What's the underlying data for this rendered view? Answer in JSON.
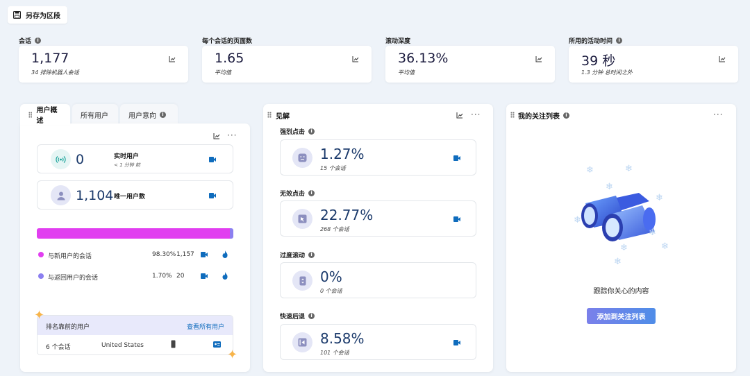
{
  "toolbar": {
    "save_segment_label": "另存为区段"
  },
  "metrics": [
    {
      "label": "会话",
      "value": "1,177",
      "sub": "34 排除机器人会话",
      "has_info": true
    },
    {
      "label": "每个会话的页面数",
      "value": "1.65",
      "sub": "平均值",
      "has_info": false
    },
    {
      "label": "滚动深度",
      "value": "36.13%",
      "sub": "平均值",
      "has_info": false
    },
    {
      "label": "所用的活动时间",
      "value": "39 秒",
      "sub": "1.3 分钟 总时间之外",
      "has_info": true
    }
  ],
  "user_panel": {
    "tabs": [
      "用户概述",
      "所有用户",
      "用户意向"
    ],
    "realtime": {
      "value": "0",
      "label": "实时用户",
      "sub": "< 1 分钟 前"
    },
    "unique": {
      "value": "1,104",
      "label": "唯一用户数"
    },
    "bar": {
      "new_fraction": 0.983,
      "new_color": "#e13ef0",
      "return_color": "#8c7ff0"
    },
    "legend": [
      {
        "label": "与新用户的会话",
        "pct": "98.30%",
        "count": "1,157",
        "color": "#e13ef0"
      },
      {
        "label": "与返回用户的会话",
        "pct": "1.70%",
        "count": "20",
        "color": "#8c7ff0"
      }
    ],
    "top_users": {
      "title": "排名靠前的用户",
      "link": "查看所有用户",
      "row": {
        "sessions": "6 个会话",
        "country": "United States"
      }
    }
  },
  "insights": {
    "title": "见解",
    "items": [
      {
        "label": "强烈点击",
        "value": "1.27%",
        "sub": "15 个会话"
      },
      {
        "label": "无效点击",
        "value": "22.77%",
        "sub": "268 个会话"
      },
      {
        "label": "过度滚动",
        "value": "0%",
        "sub": "0 个会话"
      },
      {
        "label": "快速后退",
        "value": "8.58%",
        "sub": "101 个会话"
      }
    ]
  },
  "watchlist": {
    "title": "我的关注列表",
    "empty_text": "跟踪你关心的内容",
    "add_button": "添加到关注列表"
  },
  "colors": {
    "accent": "#0f6cbd",
    "page_bg": "#eef3f9",
    "button_bg": "#6a7ee8"
  },
  "icons": [
    "save-icon",
    "info-icon",
    "chart-icon",
    "more-icon",
    "broadcast-icon",
    "person-icon",
    "camera-icon",
    "fire-icon",
    "phone-icon",
    "id-card-icon",
    "sad-face-icon",
    "cursor-icon",
    "scroll-icon",
    "back-icon",
    "binoculars-icon"
  ]
}
